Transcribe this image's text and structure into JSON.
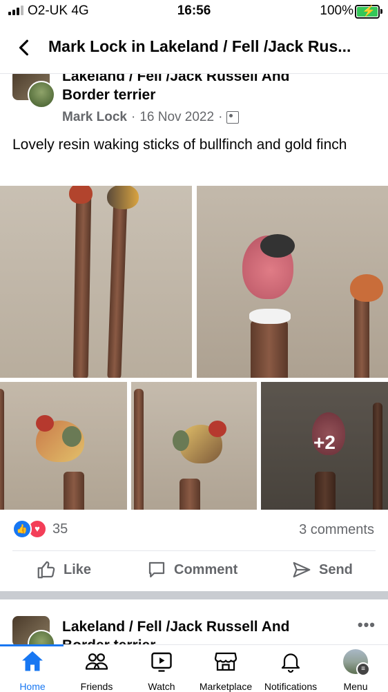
{
  "status_bar": {
    "carrier": "O2-UK",
    "network": "4G",
    "time": "16:56",
    "battery": "100%"
  },
  "header": {
    "title": "Mark Lock in Lakeland / Fell /Jack Rus..."
  },
  "post": {
    "group_name_line1": "Lakeland / Fell /Jack Russell And",
    "group_name_line2": "Border terrier",
    "author": "Mark Lock",
    "date": "16 Nov 2022",
    "sep": "·",
    "text": "Lovely resin waking sticks of bullfinch and gold finch",
    "more_photos": "+2",
    "reaction_count": "35",
    "comments": "3 comments"
  },
  "actions": {
    "like": "Like",
    "comment": "Comment",
    "send": "Send"
  },
  "next_post": {
    "group_name_line1": "Lakeland / Fell /Jack Russell And",
    "group_name_line2": "Border terrier",
    "more_menu": "•••"
  },
  "tabbar": {
    "home": "Home",
    "friends": "Friends",
    "watch": "Watch",
    "marketplace": "Marketplace",
    "notifications": "Notifications",
    "menu": "Menu"
  },
  "colors": {
    "accent": "#1877f2",
    "love": "#f33e58",
    "secondary_text": "#65676b"
  }
}
